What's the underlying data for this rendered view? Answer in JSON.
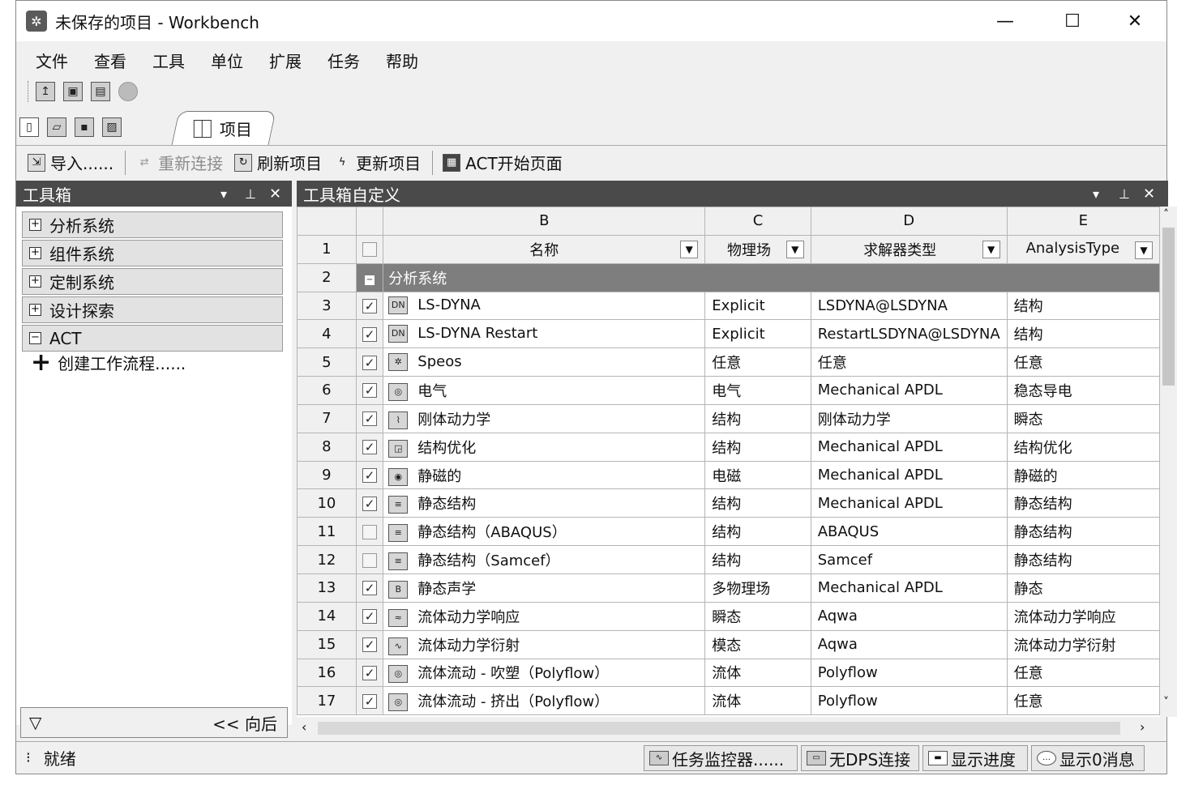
{
  "window": {
    "title": "未保存的项目 - Workbench",
    "minimize": "—",
    "maximize": "☐",
    "close": "✕"
  },
  "menu": [
    "文件",
    "查看",
    "工具",
    "单位",
    "扩展",
    "任务",
    "帮助"
  ],
  "tab": {
    "label": "项目"
  },
  "actions": {
    "import": "导入......",
    "reconnect": "重新连接",
    "refresh": "刷新项目",
    "update": "更新项目",
    "act_start": "ACT开始页面"
  },
  "toolbox": {
    "title": "工具箱",
    "groups": [
      {
        "expander": "⊞",
        "label": "分析系统"
      },
      {
        "expander": "⊞",
        "label": "组件系统"
      },
      {
        "expander": "⊞",
        "label": "定制系统"
      },
      {
        "expander": "⊞",
        "label": "设计探索"
      },
      {
        "expander": "⊟",
        "label": "ACT"
      }
    ],
    "create_workflow": "创建工作流程......",
    "back_label": "<< 向后"
  },
  "customization": {
    "title": "工具箱自定义",
    "columns": [
      "B",
      "C",
      "D",
      "E"
    ],
    "headers": {
      "name": "名称",
      "physics": "物理场",
      "solver": "求解器类型",
      "analysis": "AnalysisType"
    },
    "group_row": {
      "num": "2",
      "label": "分析系统"
    },
    "header_row_num": "1",
    "rows": [
      {
        "num": "3",
        "checked": true,
        "icon": "ls-dyna-icon",
        "name": "LS-DYNA",
        "physics": "Explicit",
        "solver": "LSDYNA@LSDYNA",
        "analysis": "结构"
      },
      {
        "num": "4",
        "checked": true,
        "icon": "ls-dyna-icon",
        "name": "LS-DYNA Restart",
        "physics": "Explicit",
        "solver": "RestartLSDYNA@LSDYNA",
        "analysis": "结构"
      },
      {
        "num": "5",
        "checked": true,
        "icon": "speos-icon",
        "name": "Speos",
        "physics": "任意",
        "solver": "任意",
        "analysis": "任意"
      },
      {
        "num": "6",
        "checked": true,
        "icon": "electric-icon",
        "name": "电气",
        "physics": "电气",
        "solver": "Mechanical APDL",
        "analysis": "稳态导电"
      },
      {
        "num": "7",
        "checked": true,
        "icon": "rigid-body-icon",
        "name": "刚体动力学",
        "physics": "结构",
        "solver": "刚体动力学",
        "analysis": "瞬态"
      },
      {
        "num": "8",
        "checked": true,
        "icon": "topology-icon",
        "name": "结构优化",
        "physics": "结构",
        "solver": "Mechanical APDL",
        "analysis": "结构优化"
      },
      {
        "num": "9",
        "checked": true,
        "icon": "magnetostatic-icon",
        "name": "静磁的",
        "physics": "电磁",
        "solver": "Mechanical APDL",
        "analysis": "静磁的"
      },
      {
        "num": "10",
        "checked": true,
        "icon": "static-structural-icon",
        "name": "静态结构",
        "physics": "结构",
        "solver": "Mechanical APDL",
        "analysis": "静态结构"
      },
      {
        "num": "11",
        "checked": false,
        "icon": "static-structural-icon",
        "name": "静态结构（ABAQUS）",
        "physics": "结构",
        "solver": "ABAQUS",
        "analysis": "静态结构"
      },
      {
        "num": "12",
        "checked": false,
        "icon": "static-structural-icon",
        "name": "静态结构（Samcef）",
        "physics": "结构",
        "solver": "Samcef",
        "analysis": "静态结构"
      },
      {
        "num": "13",
        "checked": true,
        "icon": "static-acoustics-icon",
        "name": "静态声学",
        "physics": "多物理场",
        "solver": "Mechanical APDL",
        "analysis": "静态"
      },
      {
        "num": "14",
        "checked": true,
        "icon": "hydrodynamic-response-icon",
        "name": "流体动力学响应",
        "physics": "瞬态",
        "solver": "Aqwa",
        "analysis": "流体动力学响应"
      },
      {
        "num": "15",
        "checked": true,
        "icon": "hydrodynamic-diffraction-icon",
        "name": "流体动力学衍射",
        "physics": "模态",
        "solver": "Aqwa",
        "analysis": "流体动力学衍射"
      },
      {
        "num": "16",
        "checked": true,
        "icon": "polyflow-icon",
        "name": "流体流动 - 吹塑（Polyflow）",
        "physics": "流体",
        "solver": "Polyflow",
        "analysis": "任意"
      },
      {
        "num": "17",
        "checked": true,
        "icon": "polyflow-icon",
        "name": "流体流动 - 挤出（Polyflow）",
        "physics": "流体",
        "solver": "Polyflow",
        "analysis": "任意"
      }
    ]
  },
  "status": {
    "text": "就绪",
    "task_monitor": "任务监控器......",
    "dps": "无DPS连接",
    "progress": "显示进度",
    "messages": "显示0消息"
  }
}
